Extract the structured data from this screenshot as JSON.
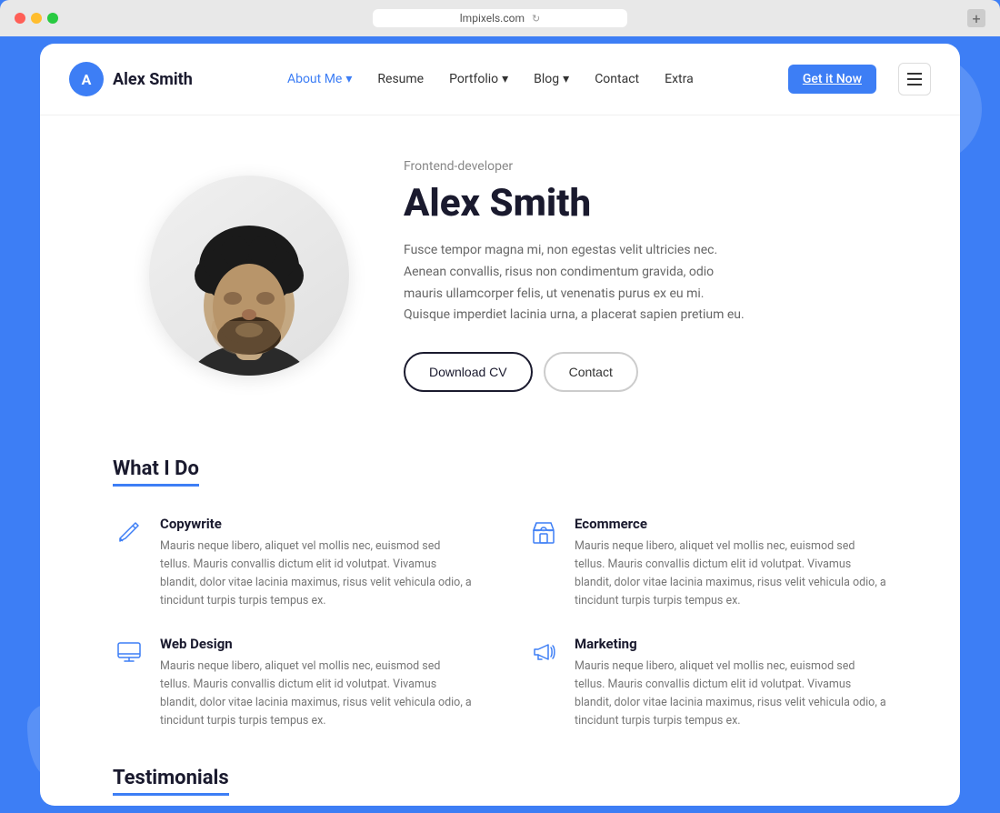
{
  "browser": {
    "url": "lmpixels.com",
    "new_tab_label": "+"
  },
  "nav": {
    "logo_initial": "A",
    "logo_name": "Alex Smith",
    "links": [
      {
        "label": "About Me",
        "has_dropdown": true,
        "active": true
      },
      {
        "label": "Resume",
        "has_dropdown": false
      },
      {
        "label": "Portfolio",
        "has_dropdown": true
      },
      {
        "label": "Blog",
        "has_dropdown": true
      },
      {
        "label": "Contact",
        "has_dropdown": false
      },
      {
        "label": "Extra",
        "has_dropdown": false
      }
    ],
    "cta_label": "Get it Now"
  },
  "hero": {
    "subtitle": "Frontend-developer",
    "name": "Alex Smith",
    "bio": "Fusce tempor magna mi, non egestas velit ultricies nec. Aenean convallis, risus non condimentum gravida, odio mauris ullamcorper felis, ut venenatis purus ex eu mi. Quisque imperdiet lacinia urna, a placerat sapien pretium eu.",
    "btn_cv": "Download CV",
    "btn_contact": "Contact"
  },
  "what_i_do": {
    "title": "What I Do",
    "services": [
      {
        "icon": "pencil",
        "title": "Copywrite",
        "description": "Mauris neque libero, aliquet vel mollis nec, euismod sed tellus. Mauris convallis dictum elit id volutpat. Vivamus blandit, dolor vitae lacinia maximus, risus velit vehicula odio, a tincidunt turpis turpis tempus ex."
      },
      {
        "icon": "store",
        "title": "Ecommerce",
        "description": "Mauris neque libero, aliquet vel mollis nec, euismod sed tellus. Mauris convallis dictum elit id volutpat. Vivamus blandit, dolor vitae lacinia maximus, risus velit vehicula odio, a tincidunt turpis turpis tempus ex."
      },
      {
        "icon": "monitor",
        "title": "Web Design",
        "description": "Mauris neque libero, aliquet vel mollis nec, euismod sed tellus. Mauris convallis dictum elit id volutpat. Vivamus blandit, dolor vitae lacinia maximus, risus velit vehicula odio, a tincidunt turpis turpis tempus ex."
      },
      {
        "icon": "megaphone",
        "title": "Marketing",
        "description": "Mauris neque libero, aliquet vel mollis nec, euismod sed tellus. Mauris convallis dictum elit id volutpat. Vivamus blandit, dolor vitae lacinia maximus, risus velit vehicula odio, a tincidunt turpis turpis tempus ex."
      }
    ]
  },
  "testimonials": {
    "title": "Testimonials"
  }
}
